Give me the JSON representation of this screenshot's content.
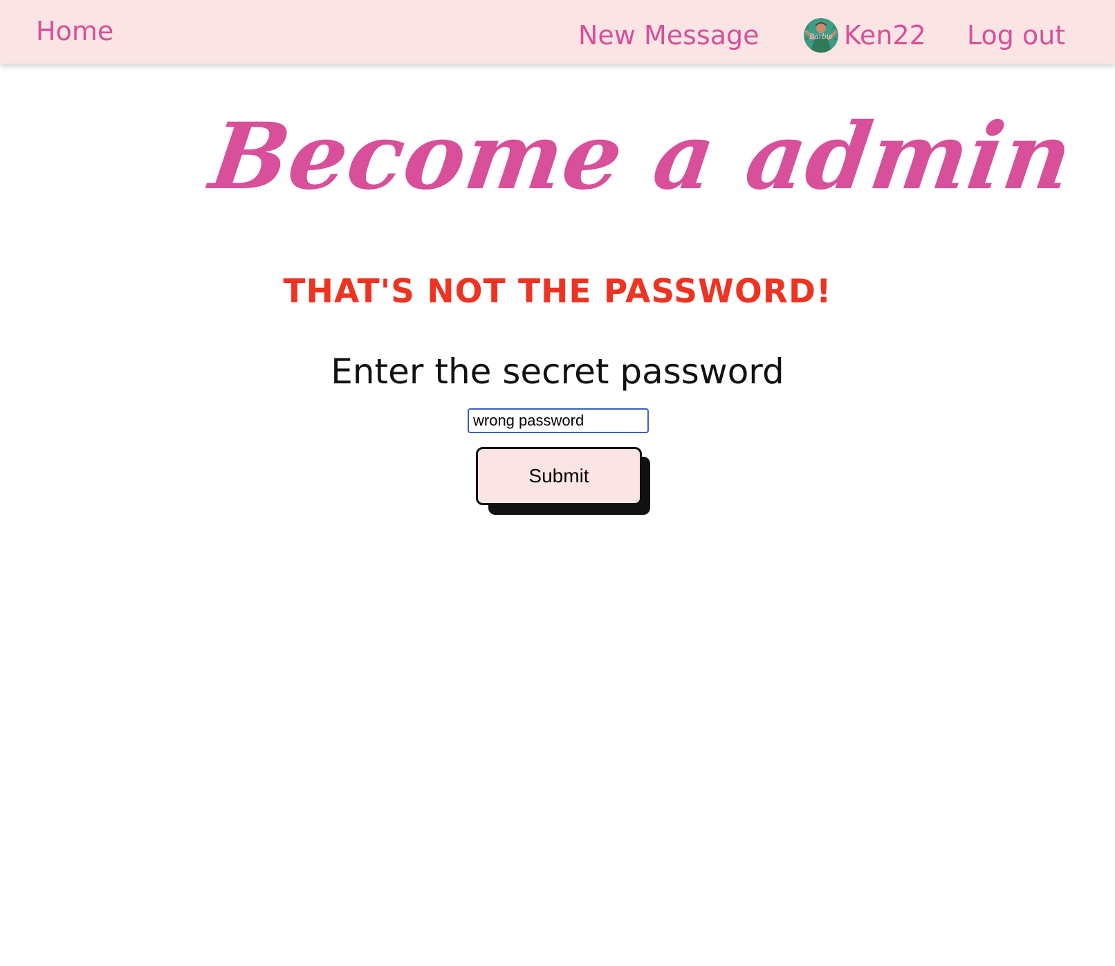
{
  "nav": {
    "home_label": "Home",
    "new_message_label": "New Message",
    "username": "Ken22",
    "avatar_badge_text": "Barbie",
    "logout_label": "Log out"
  },
  "main": {
    "title": "Become a admin",
    "error_message": "THAT'S NOT THE PASSWORD!",
    "prompt": "Enter the secret password",
    "password_value": "wrong password",
    "submit_label": "Submit"
  },
  "colors": {
    "brand_pink": "#d84f9a",
    "nav_background": "#fbe5e4",
    "error_red": "#ee3322",
    "input_focus_border": "#3860c8",
    "button_shadow": "#111111"
  },
  "icons": {
    "avatar": "user-avatar-photo"
  }
}
